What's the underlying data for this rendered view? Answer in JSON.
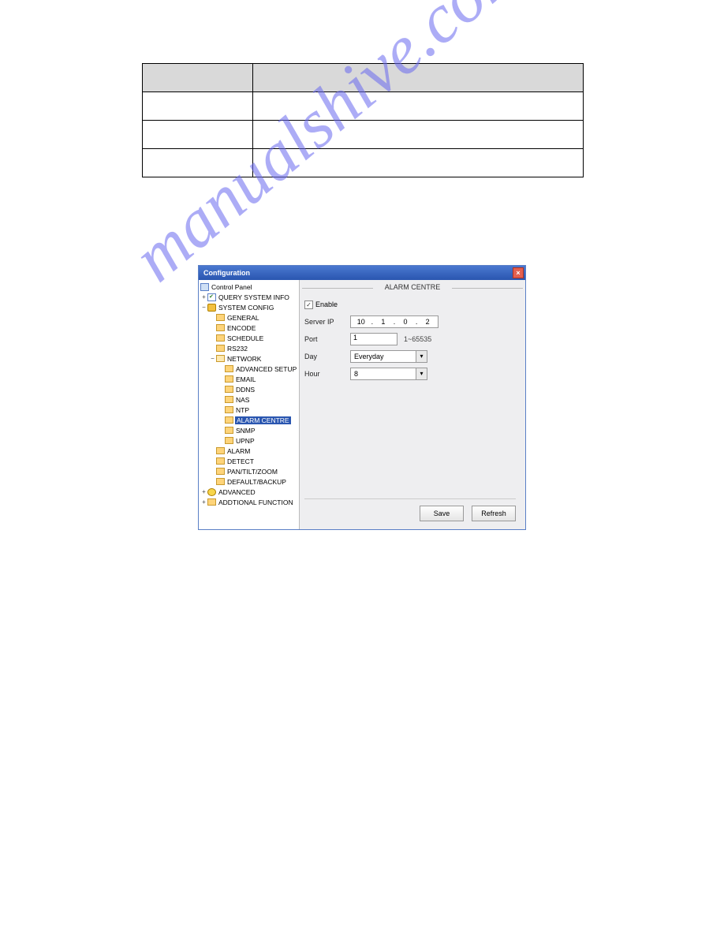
{
  "window": {
    "title": "Configuration"
  },
  "tree": {
    "root": "Control Panel",
    "query": "QUERY SYSTEM INFO",
    "sys": "SYSTEM CONFIG",
    "general": "GENERAL",
    "encode": "ENCODE",
    "schedule": "SCHEDULE",
    "rs232": "RS232",
    "network": "NETWORK",
    "advsetup": "ADVANCED SETUP",
    "email": "EMAIL",
    "ddns": "DDNS",
    "nas": "NAS",
    "ntp": "NTP",
    "alarmcentre": "ALARM CENTRE",
    "snmp": "SNMP",
    "upnp": "UPNP",
    "alarm": "ALARM",
    "detect": "DETECT",
    "ptz": "PAN/TILT/ZOOM",
    "defback": "DEFAULT/BACKUP",
    "advanced": "ADVANCED",
    "addfunc": "ADDTIONAL FUNCTION"
  },
  "panel": {
    "title": "ALARM CENTRE",
    "enable_label": "Enable",
    "enable_checked": "✓",
    "serverip_label": "Server IP",
    "ip": {
      "a": "10",
      "b": "1",
      "c": "0",
      "d": "2"
    },
    "port_label": "Port",
    "port_value": "1",
    "port_hint": "1~65535",
    "day_label": "Day",
    "day_value": "Everyday",
    "hour_label": "Hour",
    "hour_value": "8",
    "save": "Save",
    "refresh": "Refresh"
  },
  "watermark": "manualshive.com"
}
